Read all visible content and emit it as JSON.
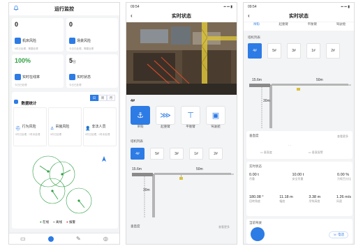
{
  "screen1": {
    "title": "运行监控",
    "cards": [
      {
        "value": "0",
        "unit": "",
        "label": "机床风险",
        "sub": "0件已处理，需要处理"
      },
      {
        "value": "0",
        "unit": "",
        "label": "场景风险",
        "sub": "今日已处理，需要处理"
      },
      {
        "value": "100%",
        "unit": "",
        "label": "实时在线率",
        "sub": "今日已处理"
      },
      {
        "value": "5",
        "unit": "台",
        "label": "实时状态",
        "sub": "今日已处理"
      }
    ],
    "stats_title": "数据统计",
    "stats_tabs": [
      "日",
      "周",
      "月"
    ],
    "risks": [
      {
        "label": "行为风险",
        "sub": "0件已处理，0件未处理"
      },
      {
        "label": "吊装风险",
        "sub": "0件已处理"
      },
      {
        "label": "非法人员",
        "sub": "0件已处理，0件未处理"
      }
    ],
    "legend": [
      "在线",
      "离线",
      "报警"
    ],
    "legend_colors": [
      "#2ea043",
      "#999999",
      "#e5484d"
    ]
  },
  "screen2": {
    "time": "09:54",
    "title": "实时状态",
    "tower_id": "4#",
    "tools": [
      {
        "label": "吊钩",
        "icon": "hook-icon"
      },
      {
        "label": "起重臂",
        "icon": "jib-icon"
      },
      {
        "label": "平衡臂",
        "icon": "counter-jib-icon"
      },
      {
        "label": "驾驶舱",
        "icon": "cab-icon"
      }
    ],
    "tower_list_title": "塔机列表",
    "towers": [
      "4#",
      "5#",
      "3#",
      "1#",
      "2#"
    ],
    "dim_jib": "15.6m",
    "dim_total": "50m",
    "dim_height": "30m",
    "footer_left": "垂直度",
    "footer_right": "查看更多"
  },
  "screen3": {
    "time": "09:54",
    "title": "实时状态",
    "top_tabs": [
      "吊钩",
      "起重臂",
      "平衡臂",
      "驾驶舱"
    ],
    "tower_list_title": "塔机列表",
    "towers": [
      "4#",
      "5#",
      "3#",
      "1#",
      "2#"
    ],
    "dim_jib": "15.6m",
    "dim_total": "50m",
    "dim_height": "30m",
    "vert_title": "垂直度",
    "vert_more": "查看更多",
    "vert_items": [
      "垂直度",
      "垂直报警"
    ],
    "realtime_title": "实时状态",
    "metrics_row1": [
      {
        "value": "0.00 t",
        "label": "吊重"
      },
      {
        "value": "10.00 t",
        "label": "安全吊重"
      },
      {
        "value": "0.00 %",
        "label": "力矩百分比"
      }
    ],
    "metrics_row2": [
      {
        "value": "180.08 °",
        "label": "回转角度"
      },
      {
        "value": "11.18 m",
        "label": "幅度"
      },
      {
        "value": "3.38 m",
        "label": "吊钩高度"
      },
      {
        "value": "1.26 m/s",
        "label": "风速"
      }
    ],
    "operator_title": "当前驾驶",
    "call_label": "电话"
  }
}
